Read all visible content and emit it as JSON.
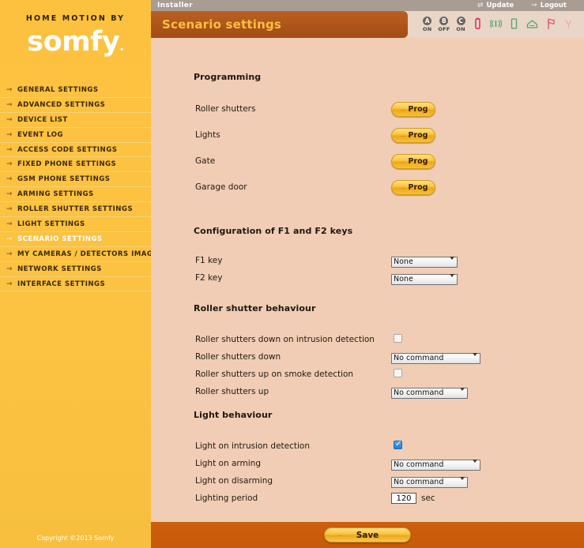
{
  "brand": {
    "tagline": "HOME MOTION BY",
    "name": "somfy",
    "copyright": "Copyright ©2013 Somfy"
  },
  "sidebar": {
    "items": [
      {
        "label": "GENERAL SETTINGS",
        "active": false
      },
      {
        "label": "ADVANCED SETTINGS",
        "active": false
      },
      {
        "label": "DEVICE LIST",
        "active": false
      },
      {
        "label": "EVENT LOG",
        "active": false
      },
      {
        "label": "ACCESS CODE SETTINGS",
        "active": false
      },
      {
        "label": "FIXED PHONE SETTINGS",
        "active": false
      },
      {
        "label": "GSM PHONE SETTINGS",
        "active": false
      },
      {
        "label": "ARMING SETTINGS",
        "active": false
      },
      {
        "label": "ROLLER SHUTTER SETTINGS",
        "active": false
      },
      {
        "label": "LIGHT SETTINGS",
        "active": false
      },
      {
        "label": "SCENARIO SETTINGS",
        "active": true
      },
      {
        "label": "MY CAMERAS / DETECTORS IMAGES",
        "active": false
      },
      {
        "label": "NETWORK SETTINGS",
        "active": false
      },
      {
        "label": "INTERFACE SETTINGS",
        "active": false
      }
    ]
  },
  "topbar": {
    "user": "Installer",
    "update_label": "Update",
    "update_icon": "refresh-icon",
    "logout_label": "Logout",
    "logout_icon": "arrow-right-icon"
  },
  "header": {
    "title": "Scenario settings"
  },
  "status_icons": {
    "zones": [
      {
        "id": "A",
        "state": "ON"
      },
      {
        "id": "B",
        "state": "OFF"
      },
      {
        "id": "C",
        "state": "ON"
      }
    ],
    "icons": [
      {
        "name": "battery-icon",
        "color": "#d9265c"
      },
      {
        "name": "radio-signal-icon",
        "color": "#4aa86a"
      },
      {
        "name": "keypad-icon",
        "color": "#4aa86a"
      },
      {
        "name": "home-icon",
        "color": "#4aa86a"
      },
      {
        "name": "flag-icon",
        "color": "#e0557e"
      },
      {
        "name": "antenna-icon",
        "color": "#e9a9bc"
      },
      {
        "name": "device-icon",
        "color": "#4aa86a"
      }
    ]
  },
  "sections": {
    "programming": {
      "title": "Programming",
      "rows": [
        {
          "label": "Roller shutters",
          "button": "Prog"
        },
        {
          "label": "Lights",
          "button": "Prog"
        },
        {
          "label": "Gate",
          "button": "Prog"
        },
        {
          "label": "Garage door",
          "button": "Prog"
        }
      ]
    },
    "fkeys": {
      "title": "Configuration of F1 and F2 keys",
      "rows": [
        {
          "label": "F1 key",
          "value": "None"
        },
        {
          "label": "F2 key",
          "value": "None"
        }
      ],
      "options": [
        "None"
      ]
    },
    "roller": {
      "title": "Roller shutter behaviour",
      "rows": [
        {
          "label": "Roller shutters down on intrusion detection",
          "type": "checkbox",
          "checked": false
        },
        {
          "label": "Roller shutters down",
          "type": "select",
          "value": "No command"
        },
        {
          "label": "Roller shutters up on smoke detection",
          "type": "checkbox",
          "checked": false
        },
        {
          "label": "Roller shutters up",
          "type": "select",
          "value": "No command"
        }
      ],
      "options": [
        "No command"
      ]
    },
    "light": {
      "title": "Light behaviour",
      "rows": [
        {
          "label": "Light on intrusion detection",
          "type": "checkbox",
          "checked": true
        },
        {
          "label": "Light on arming",
          "type": "select",
          "value": "No command"
        },
        {
          "label": "Light on disarming",
          "type": "select",
          "value": "No command"
        },
        {
          "label": "Lighting period",
          "type": "number",
          "value": "120",
          "unit": "sec"
        }
      ],
      "options": [
        "No command"
      ]
    }
  },
  "footer": {
    "save_label": "Save"
  },
  "colors": {
    "sidebar": "#fbc040",
    "content_bg": "#f0cdb4",
    "banner": "#b0571b",
    "banner_text": "#fbc040",
    "footer": "#c85a09",
    "button": "#fbc540"
  }
}
